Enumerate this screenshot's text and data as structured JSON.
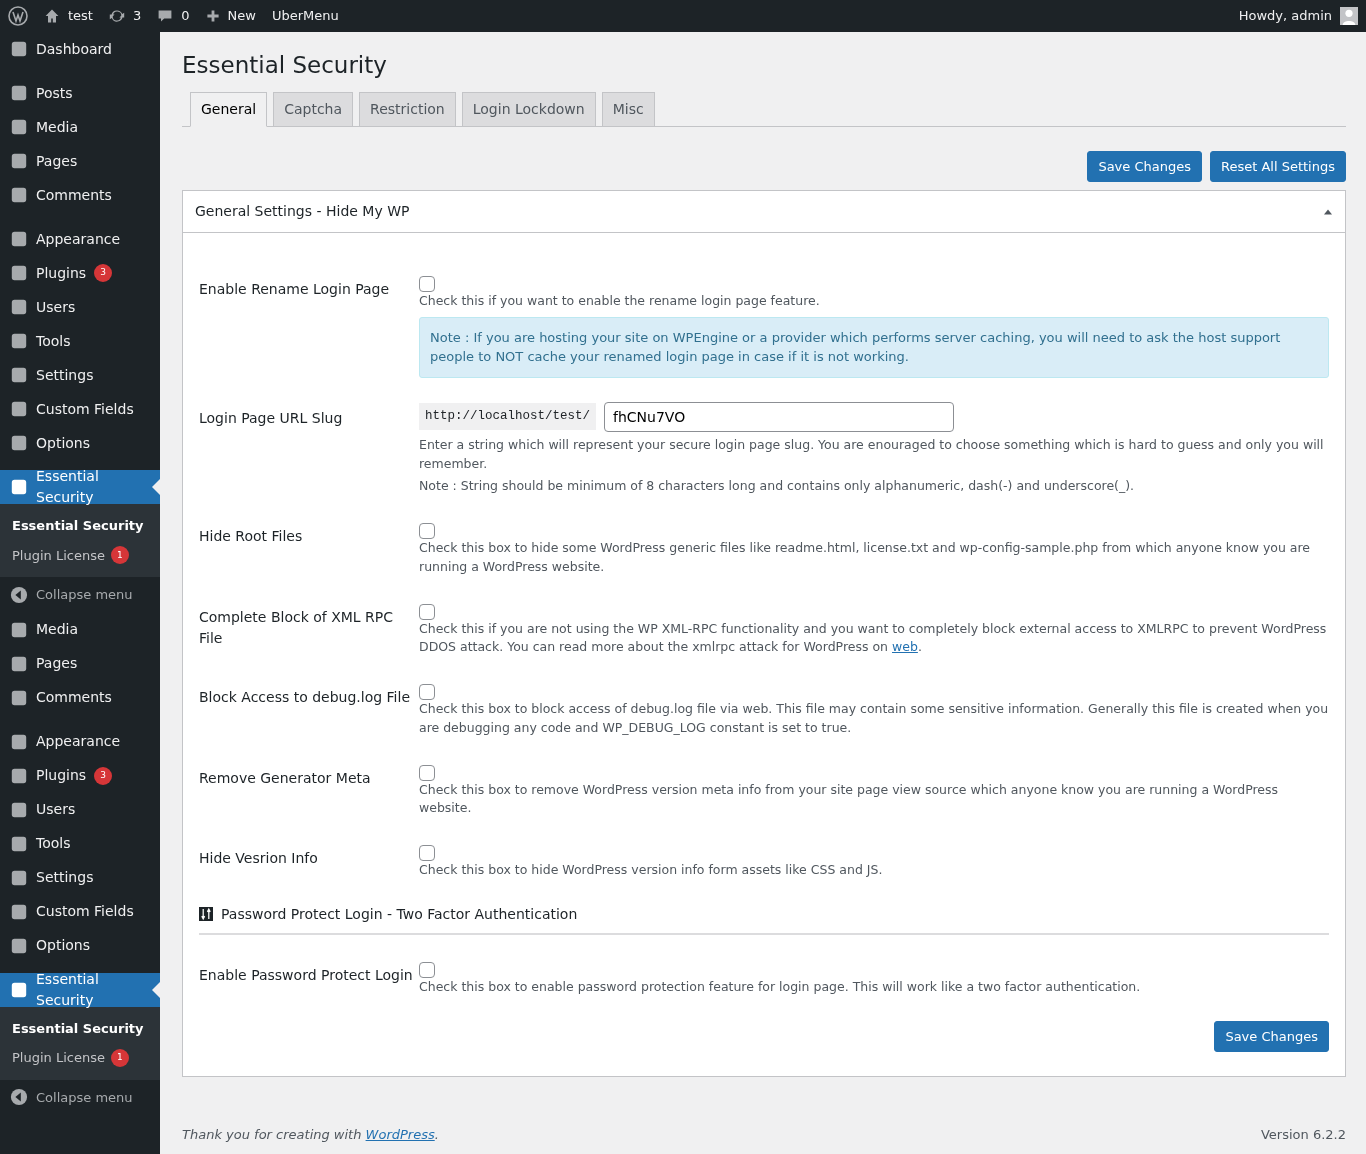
{
  "adminbar": {
    "site": "test",
    "updates": "3",
    "comments": "0",
    "new": "New",
    "extra": "UberMenu",
    "greeting": "Howdy, admin"
  },
  "sidebar": [
    {
      "groups": [
        [
          {
            "label": "Dashboard",
            "selected": false
          }
        ],
        [
          {
            "label": "Posts",
            "selected": false
          },
          {
            "label": "Media",
            "selected": false
          },
          {
            "label": "Pages",
            "selected": false
          },
          {
            "label": "Comments",
            "selected": false
          }
        ],
        [
          {
            "label": "Appearance",
            "selected": false
          },
          {
            "label": "Plugins",
            "badge": "3",
            "selected": false
          },
          {
            "label": "Users",
            "selected": false
          },
          {
            "label": "Tools",
            "selected": false
          },
          {
            "label": "Settings",
            "selected": false
          },
          {
            "label": "Custom Fields",
            "selected": false
          },
          {
            "label": "Options",
            "selected": false
          }
        ],
        [
          {
            "label": "Essential Security",
            "selected": true
          }
        ]
      ],
      "submenu": [
        {
          "label": "Essential Security",
          "selected": true
        },
        {
          "label": "Plugin License",
          "badge": "1",
          "selected": false
        }
      ],
      "collapse": "Collapse menu"
    },
    {
      "groups": [
        [
          {
            "label": "Media",
            "selected": false
          },
          {
            "label": "Pages",
            "selected": false
          },
          {
            "label": "Comments",
            "selected": false
          }
        ],
        [
          {
            "label": "Appearance",
            "selected": false
          },
          {
            "label": "Plugins",
            "badge": "3",
            "selected": false
          },
          {
            "label": "Users",
            "selected": false
          },
          {
            "label": "Tools",
            "selected": false
          },
          {
            "label": "Settings",
            "selected": false
          },
          {
            "label": "Custom Fields",
            "selected": false
          },
          {
            "label": "Options",
            "selected": false
          }
        ],
        [
          {
            "label": "Essential Security",
            "selected": true
          }
        ]
      ],
      "submenu": [
        {
          "label": "Essential Security",
          "selected": true
        },
        {
          "label": "Plugin License",
          "badge": "1",
          "selected": false
        }
      ],
      "collapse": "Collapse menu"
    }
  ],
  "page_title": "Essential Security",
  "tabs": [
    {
      "label": "General",
      "selected": true
    },
    {
      "label": "Captcha",
      "selected": false
    },
    {
      "label": "Restriction",
      "selected": false
    },
    {
      "label": "Login Lockdown",
      "selected": false
    },
    {
      "label": "Misc",
      "selected": false
    }
  ],
  "top_buttons": [
    "Save Changes",
    "Reset All Settings"
  ],
  "panel": {
    "title": "General Settings - Hide My WP",
    "expanded": true,
    "sections": [
      {
        "rows": [
          {
            "kind": "checkbox",
            "label": "Enable Rename Login Page",
            "checked": false,
            "desc": "Check this if you want to enable the rename login page feature.",
            "note": "Note : If you are hosting your site on WPEngine or a provider which performs server caching, you will need to ask the host support people to NOT cache your renamed login page in case if it is not working."
          },
          {
            "kind": "slug",
            "label": "Login Page URL Slug",
            "prefix": "http://localhost/test/",
            "value": "fhCNu7VO",
            "desc": "Enter a string which will represent your secure login page slug. You are enouraged to choose something which is hard to guess and only you will remember.",
            "desc2": "Note : String should be minimum of 8 characters long and contains only alphanumeric, dash(-) and underscore(_)."
          },
          {
            "kind": "checkbox",
            "label": "Hide Root Files",
            "checked": false,
            "desc": "Check this box to hide some WordPress generic files like readme.html, license.txt and wp-config-sample.php from which anyone know you are running a WordPress website."
          },
          {
            "kind": "checkbox",
            "label": "Complete Block of XML RPC File",
            "checked": false,
            "desc": "Check this if you are not using the WP XML-RPC functionality and you want to completely block external access to XMLRPC to prevent WordPress DDOS attack. You can read more about the xmlrpc attack for WordPress on",
            "link": "web",
            "desc_after": "."
          },
          {
            "kind": "checkbox",
            "label": "Block Access to debug.log File",
            "checked": false,
            "desc": "Check this box to block access of debug.log file via web. This file may contain some sensitive information. Generally this file is created when you are debugging any code and WP_DEBUG_LOG constant is set to true."
          },
          {
            "kind": "checkbox",
            "label": "Remove Generator Meta",
            "checked": false,
            "desc": "Check this box to remove WordPress version meta info from your site page view source which anyone know you are running a WordPress website."
          },
          {
            "kind": "checkbox",
            "label": "Hide Vesrion Info",
            "checked": false,
            "desc": "Check this box to hide WordPress version info form assets like CSS and JS."
          }
        ]
      },
      {
        "heading": "Password Protect Login - Two Factor Authentication",
        "rows": [
          {
            "kind": "checkbox",
            "label": "Enable Password Protect Login",
            "checked": false,
            "desc": "Check this box to enable password protection feature for login page. This will work like a two factor authentication."
          }
        ]
      }
    ],
    "save": "Save Changes"
  },
  "footer": {
    "text": "Thank you for creating with",
    "link": "WordPress",
    "after": ".",
    "version": "Version 6.2.2"
  }
}
